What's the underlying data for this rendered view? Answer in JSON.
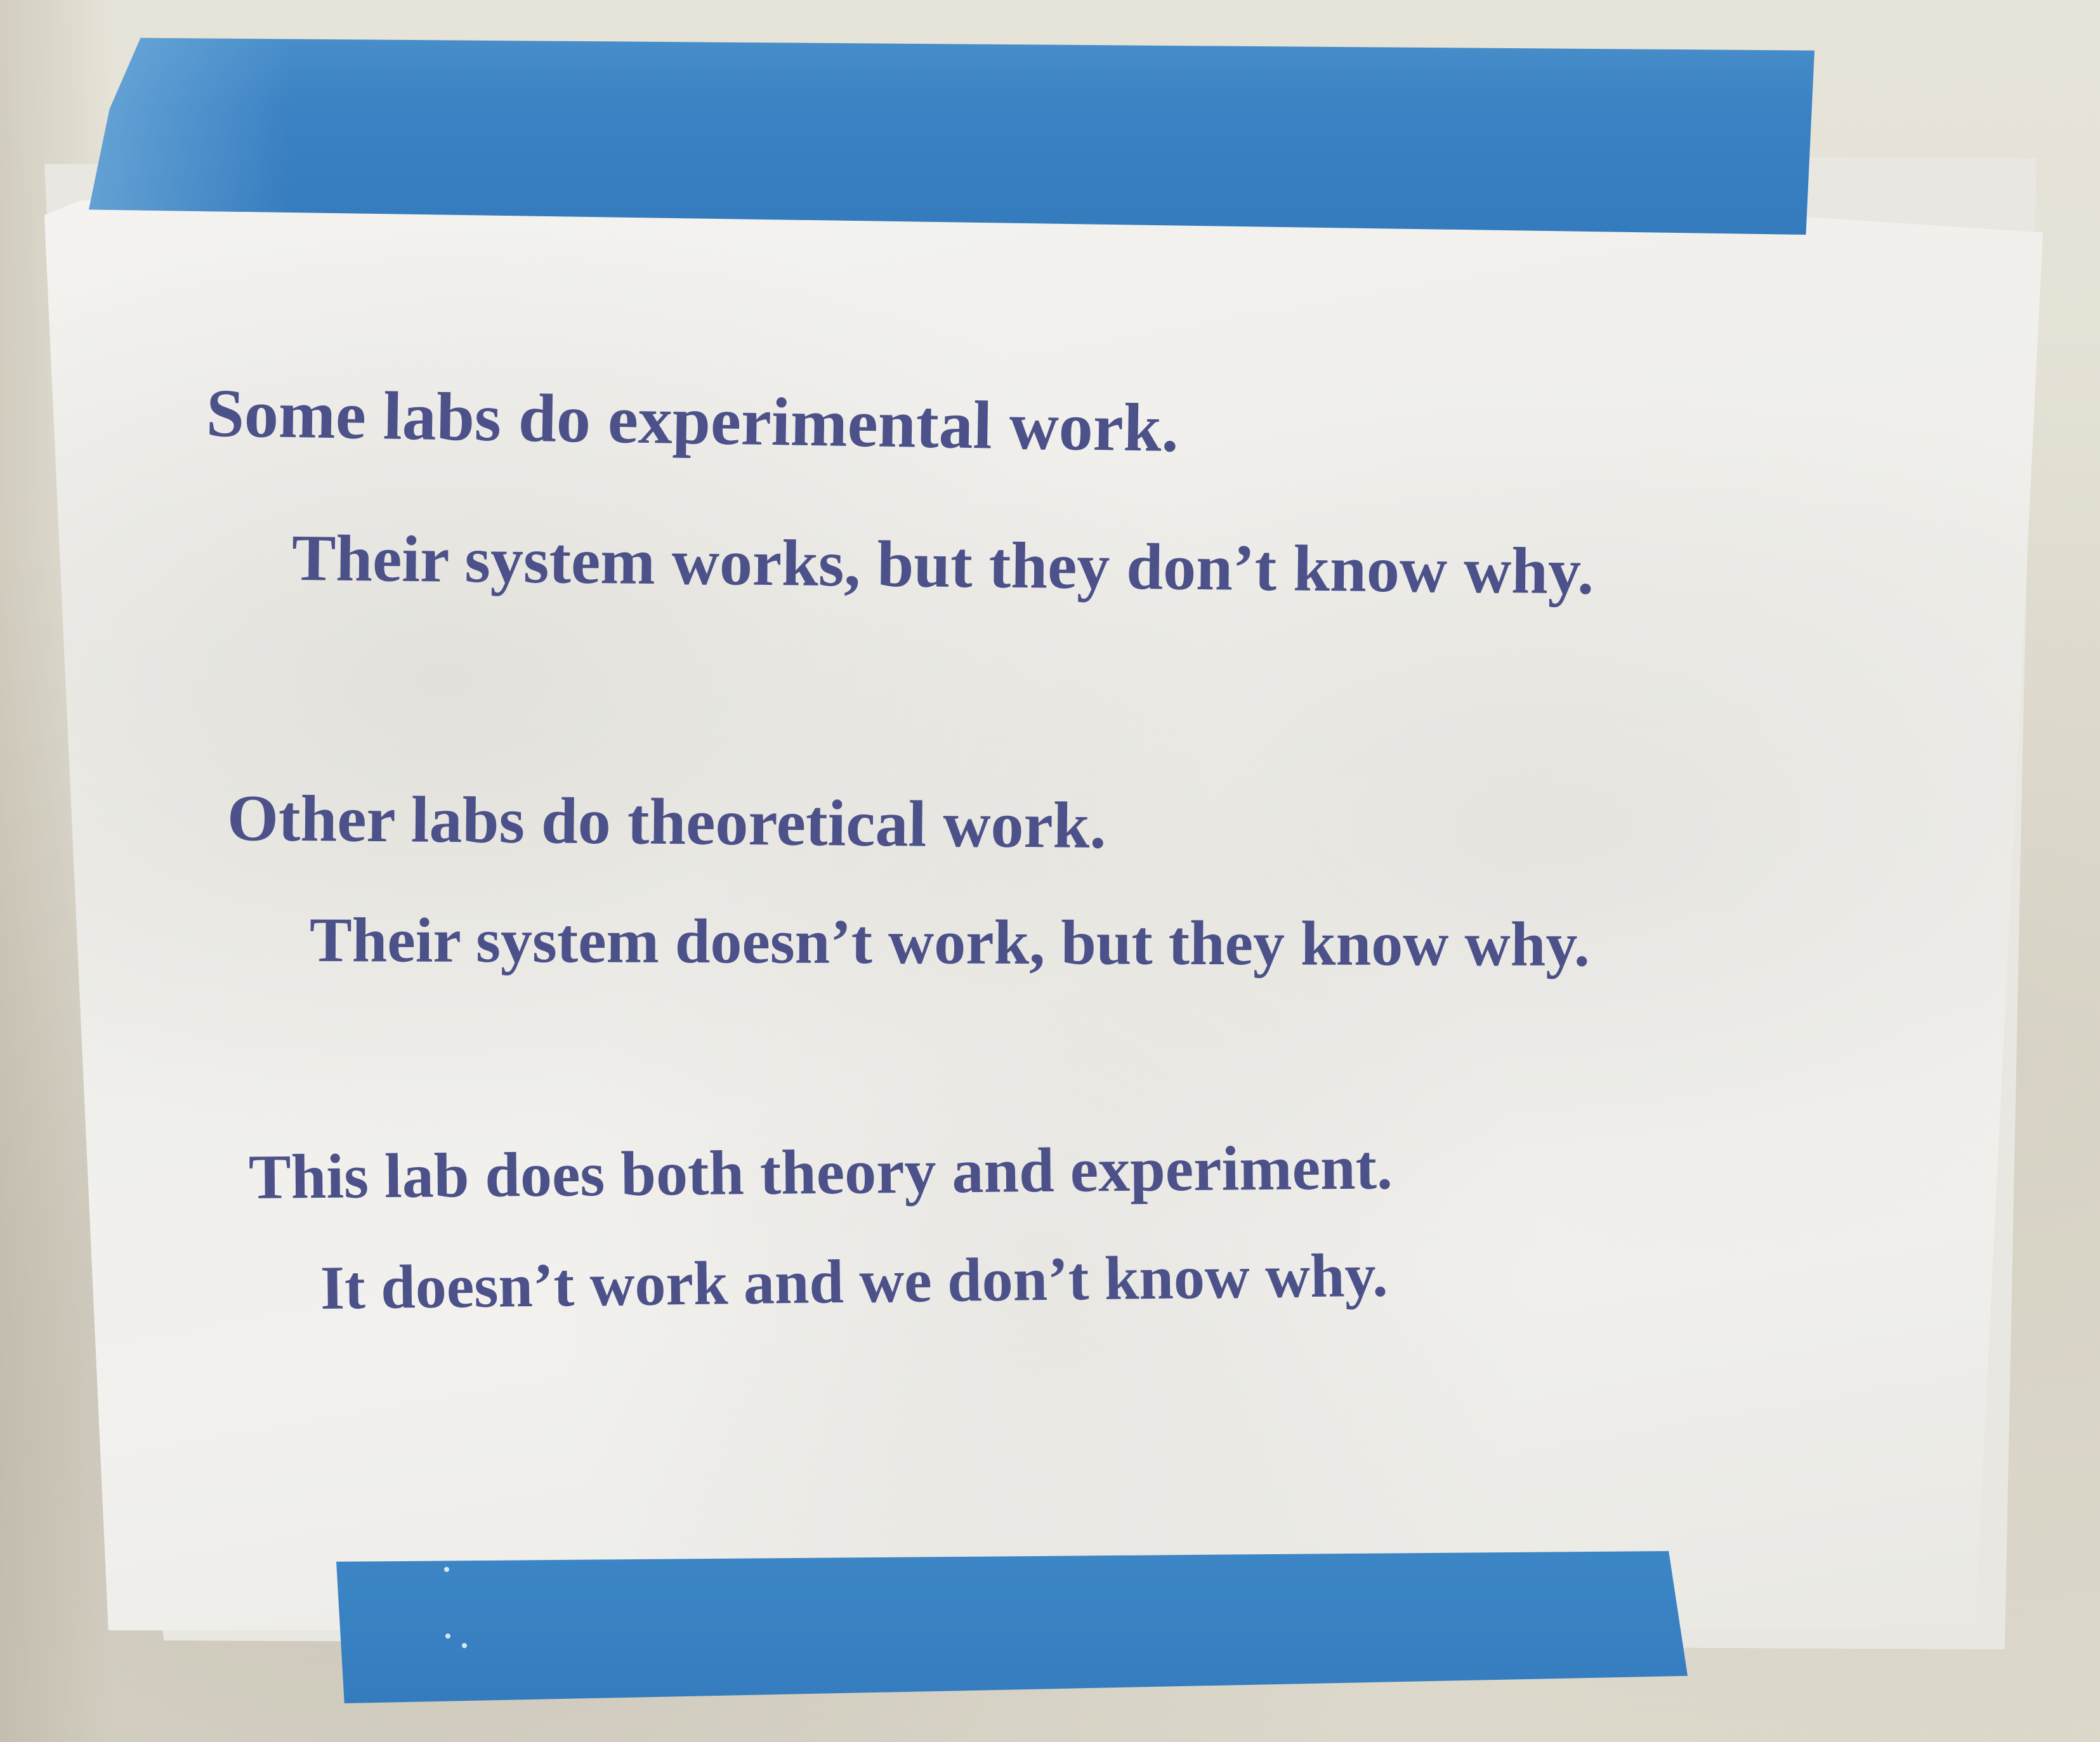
{
  "notice": {
    "lines": [
      "Some labs do experimental work.",
      "Their system works, but they don’t know why.",
      "Other labs do theoretical work.",
      "Their system doesn’t work, but they know why.",
      "This lab does both theory and experiment.",
      "It doesn’t work and we don’t know why."
    ]
  },
  "colors": {
    "ink": "#4c5289",
    "tape": "#3b82c4",
    "paper": "#f2f1ee",
    "wall": "#e3e0d4"
  }
}
